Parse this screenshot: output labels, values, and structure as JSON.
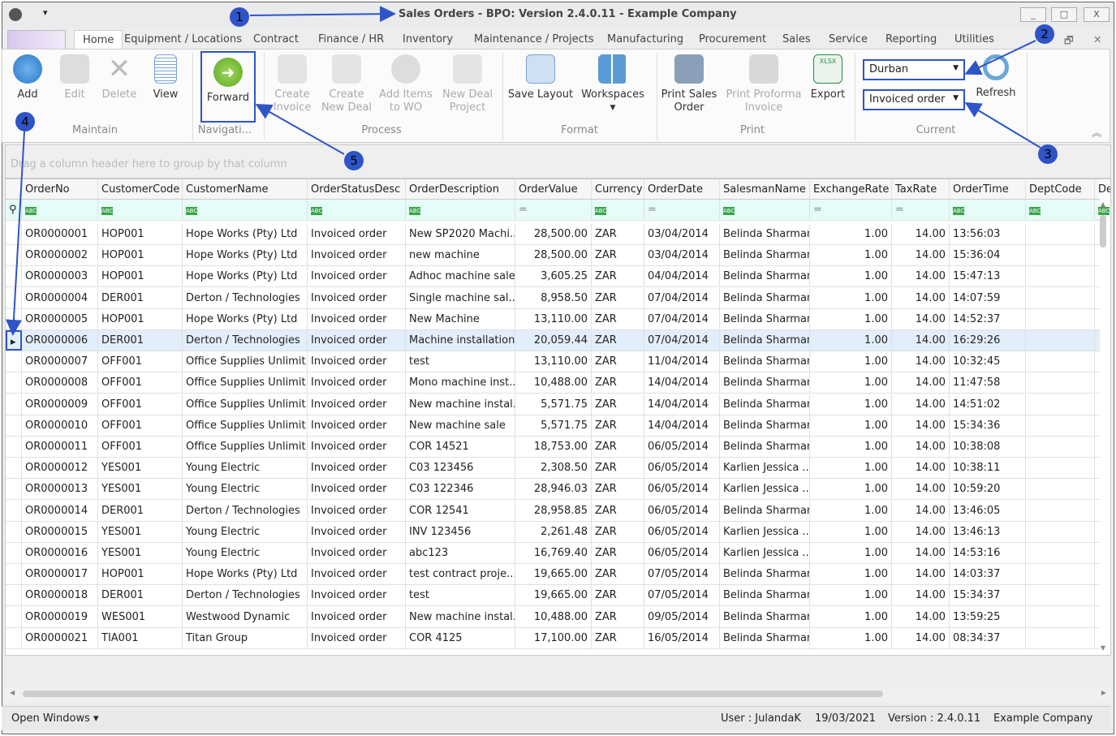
{
  "window": {
    "title": "Sales Orders - BPO: Version 2.4.0.11 - Example Company",
    "minimize": "_",
    "maximize": "□",
    "close": "X",
    "qat": "▾"
  },
  "tabs": [
    "Home",
    "Equipment / Locations",
    "Contract",
    "Finance / HR",
    "Inventory",
    "Maintenance / Projects",
    "Manufacturing",
    "Procurement",
    "Sales",
    "Service",
    "Reporting",
    "Utilities"
  ],
  "ribbon": {
    "maintain": {
      "label": "Maintain",
      "add": "Add",
      "edit": "Edit",
      "delete": "Delete",
      "view": "View"
    },
    "navigation": {
      "label": "Navigati...",
      "forward": "Forward"
    },
    "process": {
      "label": "Process",
      "create_invoice": "Create Invoice",
      "create_new_deal": "Create New Deal",
      "add_items_to_wo": "Add Items to WO",
      "new_deal_project": "New Deal Project"
    },
    "format": {
      "label": "Format",
      "save_layout": "Save Layout",
      "workspaces": "Workspaces"
    },
    "print": {
      "label": "Print",
      "print_sales_order": "Print Sales Order",
      "print_proforma_invoice": "Print Proforma Invoice",
      "export": "Export"
    },
    "current": {
      "label": "Current",
      "site": "Durban",
      "status": "Invoiced order",
      "refresh": "Refresh"
    }
  },
  "grid": {
    "group_panel": "Drag a column header here to group by that column",
    "columns": [
      "OrderNo",
      "CustomerCode",
      "CustomerName",
      "OrderStatusDesc",
      "OrderDescription",
      "OrderValue",
      "Currency",
      "OrderDate",
      "SalesmanName",
      "ExchangeRate",
      "TaxRate",
      "OrderTime",
      "DeptCode",
      "De"
    ],
    "selected_row": 5,
    "rows": [
      [
        "OR0000001",
        "HOP001",
        "Hope Works (Pty) Ltd",
        "Invoiced order",
        "New SP2020 Machi...",
        "28,500.00",
        "ZAR",
        "03/04/2014",
        "Belinda Sharman",
        "1.00",
        "14.00",
        "13:56:03",
        ""
      ],
      [
        "OR0000002",
        "HOP001",
        "Hope Works (Pty) Ltd",
        "Invoiced order",
        "new machine",
        "28,500.00",
        "ZAR",
        "03/04/2014",
        "Belinda Sharman",
        "1.00",
        "14.00",
        "15:36:04",
        ""
      ],
      [
        "OR0000003",
        "HOP001",
        "Hope Works (Pty) Ltd",
        "Invoiced order",
        "Adhoc machine sale",
        "3,605.25",
        "ZAR",
        "04/04/2014",
        "Belinda Sharman",
        "1.00",
        "14.00",
        "15:47:13",
        ""
      ],
      [
        "OR0000004",
        "DER001",
        "Derton / Technologies",
        "Invoiced order",
        "Single machine sal...",
        "8,958.50",
        "ZAR",
        "07/04/2014",
        "Belinda Sharman",
        "1.00",
        "14.00",
        "14:07:59",
        ""
      ],
      [
        "OR0000005",
        "HOP001",
        "Hope Works (Pty) Ltd",
        "Invoiced order",
        "New Machine",
        "13,110.00",
        "ZAR",
        "07/04/2014",
        "Belinda Sharman",
        "1.00",
        "14.00",
        "14:52:37",
        ""
      ],
      [
        "OR0000006",
        "DER001",
        "Derton / Technologies",
        "Invoiced order",
        "Machine installation",
        "20,059.44",
        "ZAR",
        "07/04/2014",
        "Belinda Sharman",
        "1.00",
        "14.00",
        "16:29:26",
        ""
      ],
      [
        "OR0000007",
        "OFF001",
        "Office Supplies Unlimit...",
        "Invoiced order",
        "test",
        "13,110.00",
        "ZAR",
        "11/04/2014",
        "Belinda Sharman",
        "1.00",
        "14.00",
        "10:32:45",
        ""
      ],
      [
        "OR0000008",
        "OFF001",
        "Office Supplies Unlimit...",
        "Invoiced order",
        "Mono machine inst...",
        "10,488.00",
        "ZAR",
        "14/04/2014",
        "Belinda Sharman",
        "1.00",
        "14.00",
        "11:47:58",
        ""
      ],
      [
        "OR0000009",
        "OFF001",
        "Office Supplies Unlimit...",
        "Invoiced order",
        "New machine instal...",
        "5,571.75",
        "ZAR",
        "14/04/2014",
        "Belinda Sharman",
        "1.00",
        "14.00",
        "14:51:02",
        ""
      ],
      [
        "OR0000010",
        "OFF001",
        "Office Supplies Unlimit...",
        "Invoiced order",
        "New machine sale",
        "5,571.75",
        "ZAR",
        "14/04/2014",
        "Belinda Sharman",
        "1.00",
        "14.00",
        "15:34:36",
        ""
      ],
      [
        "OR0000011",
        "OFF001",
        "Office Supplies Unlimit...",
        "Invoiced order",
        "COR 14521",
        "18,753.00",
        "ZAR",
        "06/05/2014",
        "Belinda Sharman",
        "1.00",
        "14.00",
        "10:38:08",
        ""
      ],
      [
        "OR0000012",
        "YES001",
        "Young Electric",
        "Invoiced order",
        "C03 123456",
        "2,308.50",
        "ZAR",
        "06/05/2014",
        "Karlien Jessica ...",
        "1.00",
        "14.00",
        "10:38:11",
        ""
      ],
      [
        "OR0000013",
        "YES001",
        "Young Electric",
        "Invoiced order",
        "C03 122346",
        "28,946.03",
        "ZAR",
        "06/05/2014",
        "Karlien Jessica ...",
        "1.00",
        "14.00",
        "10:59:20",
        ""
      ],
      [
        "OR0000014",
        "DER001",
        "Derton / Technologies",
        "Invoiced order",
        "COR 12541",
        "28,958.85",
        "ZAR",
        "06/05/2014",
        "Belinda Sharman",
        "1.00",
        "14.00",
        "13:46:05",
        ""
      ],
      [
        "OR0000015",
        "YES001",
        "Young Electric",
        "Invoiced order",
        "INV 123456",
        "2,261.48",
        "ZAR",
        "06/05/2014",
        "Karlien Jessica ...",
        "1.00",
        "14.00",
        "13:46:13",
        ""
      ],
      [
        "OR0000016",
        "YES001",
        "Young Electric",
        "Invoiced order",
        "abc123",
        "16,769.40",
        "ZAR",
        "06/05/2014",
        "Karlien Jessica ...",
        "1.00",
        "14.00",
        "14:53:16",
        ""
      ],
      [
        "OR0000017",
        "HOP001",
        "Hope Works (Pty) Ltd",
        "Invoiced order",
        "test contract proje...",
        "19,665.00",
        "ZAR",
        "07/05/2014",
        "Belinda Sharman",
        "1.00",
        "14.00",
        "14:03:37",
        ""
      ],
      [
        "OR0000018",
        "DER001",
        "Derton / Technologies",
        "Invoiced order",
        "test",
        "19,665.00",
        "ZAR",
        "07/05/2014",
        "Belinda Sharman",
        "1.00",
        "14.00",
        "15:34:37",
        ""
      ],
      [
        "OR0000019",
        "WES001",
        "Westwood Dynamic",
        "Invoiced order",
        "New machine instal...",
        "10,488.00",
        "ZAR",
        "09/05/2014",
        "Belinda Sharman",
        "1.00",
        "14.00",
        "13:59:25",
        ""
      ],
      [
        "OR0000021",
        "TIA001",
        "Titan Group",
        "Invoiced order",
        "COR 4125",
        "17,100.00",
        "ZAR",
        "16/05/2014",
        "Belinda Sharman",
        "1.00",
        "14.00",
        "08:34:37",
        ""
      ]
    ]
  },
  "status": {
    "open_windows": "Open Windows ▾",
    "user": "User : JulandaK",
    "date": "19/03/2021",
    "version": "Version : 2.4.0.11",
    "company": "Example Company"
  },
  "annotations": [
    "1",
    "2",
    "3",
    "4",
    "5"
  ],
  "colors": {
    "annotation": "#2e54c8",
    "forward_icon": "#6cb52d",
    "filter_row": "#e6fcf8",
    "selected_row": "#e3eefb"
  }
}
